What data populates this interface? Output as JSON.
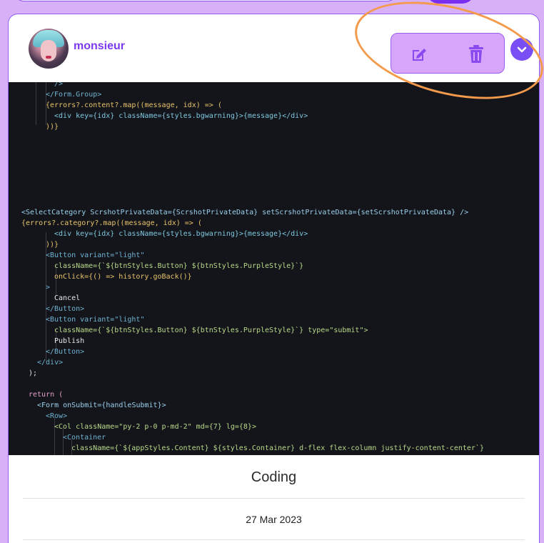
{
  "post": {
    "username": "monsieur",
    "title": "Coding",
    "date": "27 Mar 2023"
  },
  "icons": {
    "edit": "edit-icon",
    "delete": "trash-icon",
    "dropdown": "chevron-down-icon"
  },
  "colors": {
    "page_bg": "#d8b0f7",
    "accent": "#7c3aed",
    "action_box": "#d7a6fb",
    "highlight": "#f39a4c",
    "code_bg": "#14151a"
  },
  "code_lines": [
    [
      "/>"
    ],
    [
      "</Form.Group>"
    ],
    [
      "{errors?.content?.map((message, idx) => ("
    ],
    [
      "<div key={idx} className={styles.bgwarning}>{message}</div>"
    ],
    [
      "))}"
    ],
    [
      "<SelectCategory ScrshotPrivateData={ScrshotPrivateData} setScrshotPrivateData={setScrshotPrivateData} />"
    ],
    [
      "{errors?.category?.map((message, idx) => ("
    ],
    [
      "<div key={idx} className={styles.bgwarning}>{message}</div>"
    ],
    [
      "))}"
    ],
    [
      "<Button variant=\"light\""
    ],
    [
      "className={`${btnStyles.Button} ${btnStyles.PurpleStyle}`}"
    ],
    [
      "onClick={() => history.goBack()}"
    ],
    [
      ">"
    ],
    [
      "Cancel"
    ],
    [
      "</Button>"
    ],
    [
      "<Button variant=\"light\""
    ],
    [
      "className={`${btnStyles.Button} ${btnStyles.PurpleStyle}`} type=\"submit\">"
    ],
    [
      "Publish"
    ],
    [
      "</Button>"
    ],
    [
      "</div>"
    ],
    [
      ");"
    ],
    [
      "return ("
    ],
    [
      "<Form onSubmit={handleSubmit}>"
    ],
    [
      "<Row>"
    ],
    [
      "<Col className=\"py-2 p-0 p-md-2\" md={7} lg={8}>"
    ],
    [
      "<Container"
    ],
    [
      "className={`${appStyles.Content} ${styles.Container} d-flex flex-column justify-content-center`}"
    ]
  ]
}
